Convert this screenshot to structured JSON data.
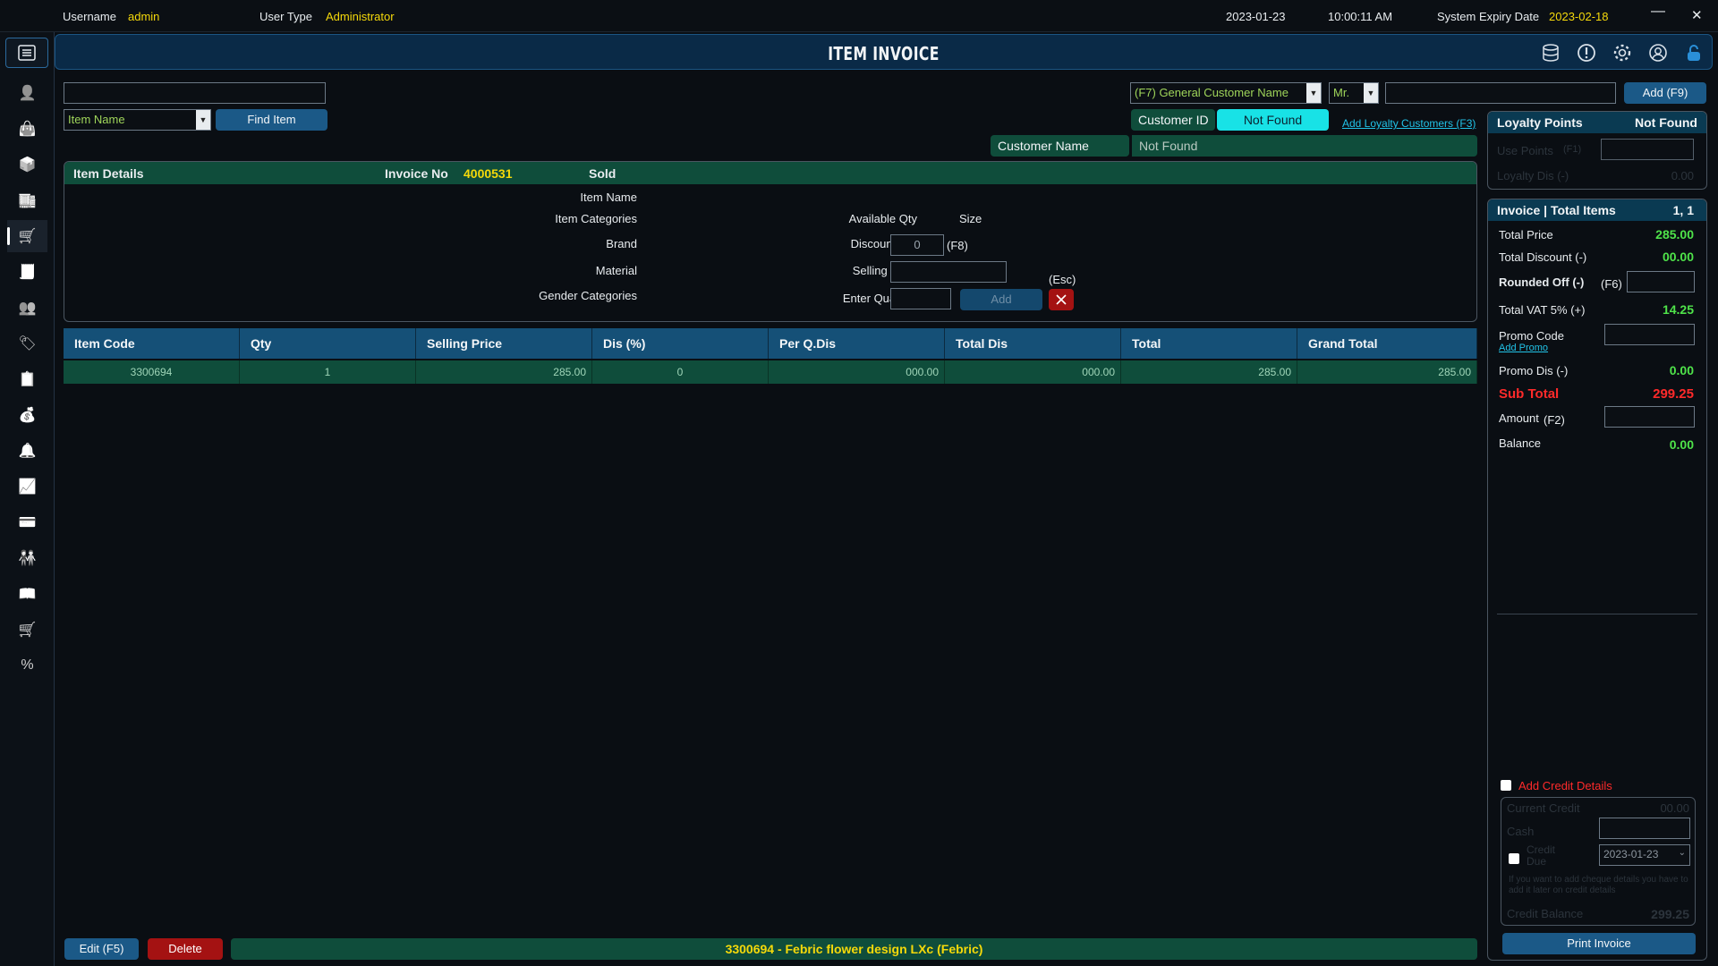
{
  "topbar": {
    "username_label": "Username",
    "username": "admin",
    "usertype_label": "User Type",
    "usertype": "Administrator",
    "date": "2023-01-23",
    "time": "10:00:11 AM",
    "expiry_label": "System Expiry Date",
    "expiry": "2023-02-18",
    "minimize": "—",
    "close": "✕"
  },
  "header": {
    "title": "ITEM INVOICE"
  },
  "sidebar": {
    "items": [
      {
        "icon": "user-icon"
      },
      {
        "icon": "bag-icon"
      },
      {
        "icon": "box-icon"
      },
      {
        "icon": "warehouse-icon"
      },
      {
        "icon": "cart-icon"
      },
      {
        "icon": "receipt-icon"
      },
      {
        "icon": "customers-icon"
      },
      {
        "icon": "tag-icon"
      },
      {
        "icon": "report-icon"
      },
      {
        "icon": "money-bag-icon"
      },
      {
        "icon": "bell-icon"
      },
      {
        "icon": "chart-icon"
      },
      {
        "icon": "card-icon"
      },
      {
        "icon": "team-icon"
      },
      {
        "icon": "book-icon"
      },
      {
        "icon": "trolley-icon"
      },
      {
        "icon": "percent-icon"
      }
    ]
  },
  "search": {
    "barcode_value": "",
    "item_select": "Item Name",
    "find_button": "Find Item"
  },
  "customer": {
    "name_select": "(F7) General Customer Name",
    "title_select": "Mr.",
    "name_input": "",
    "add_button": "Add (F9)",
    "id_label": "Customer ID",
    "id_value": "Not Found",
    "add_loyalty_link": "Add Loyalty Customers (F3)",
    "customer_name_label": "Customer Name",
    "customer_name_value": "Not Found"
  },
  "item_details": {
    "header": "Item Details",
    "invoice_label": "Invoice No",
    "invoice_no": "4000531",
    "status": "Sold",
    "item_name": "Item Name",
    "item_categories": "Item Categories",
    "brand": "Brand",
    "material": "Material",
    "gender_categories": "Gender Categories",
    "available_qty": "Available Qty",
    "size": "Size",
    "discount_label": "Discount (%)",
    "discount_value": "0",
    "discount_key": "(F8)",
    "selling_price": "Selling Price",
    "enter_quantity": "Enter Quantity",
    "add_button": "Add",
    "esc_label": "(Esc)"
  },
  "table": {
    "headers": [
      "Item Code",
      "Qty",
      "Selling Price",
      "Dis (%)",
      "Per Q.Dis",
      "Total Dis",
      "Total",
      "Grand Total"
    ],
    "rows": [
      {
        "item_code": "3300694",
        "qty": "1",
        "selling_price": "285.00",
        "dis": "0",
        "per_q_dis": "000.00",
        "total_dis": "000.00",
        "total": "285.00",
        "grand_total": "285.00"
      }
    ]
  },
  "loyalty": {
    "header": "Loyalty Points",
    "header_value": "Not Found",
    "use_points": "Use Points",
    "use_points_key": "(F1)",
    "loyalty_dis": "Loyalty Dis (-)",
    "loyalty_dis_value": "0.00"
  },
  "summary": {
    "header": "Invoice | Total Items",
    "header_value": "1, 1",
    "total_price_label": "Total Price",
    "total_price": "285.00",
    "total_discount_label": "Total Discount (-)",
    "total_discount": "00.00",
    "rounded_label": "Rounded Off (-)",
    "rounded_key": "(F6)",
    "vat_label": "Total VAT 5% (+)",
    "vat": "14.25",
    "promo_label": "Promo Code",
    "add_promo": "Add Promo",
    "promo_dis_label": "Promo Dis (-)",
    "promo_dis": "0.00",
    "subtotal_label": "Sub Total",
    "subtotal": "299.25",
    "amount_label": "Amount",
    "amount_key": "(F2)",
    "balance_label": "Balance",
    "balance": "0.00"
  },
  "credit": {
    "checkbox_label": "Add Credit Details",
    "current_credit": "Current Credit",
    "current_credit_value": "00.00",
    "cash": "Cash",
    "credit_due": "Credit Due",
    "due_date": "2023-01-23",
    "note": "If you want to add cheque details you have to add it later on credit details",
    "credit_balance": "Credit Balance",
    "credit_balance_value": "299.25",
    "print_button": "Print Invoice"
  },
  "bottom": {
    "edit_button": "Edit (F5)",
    "delete_button": "Delete",
    "status": "3300694 - Febric flower design LXc (Febric)"
  }
}
